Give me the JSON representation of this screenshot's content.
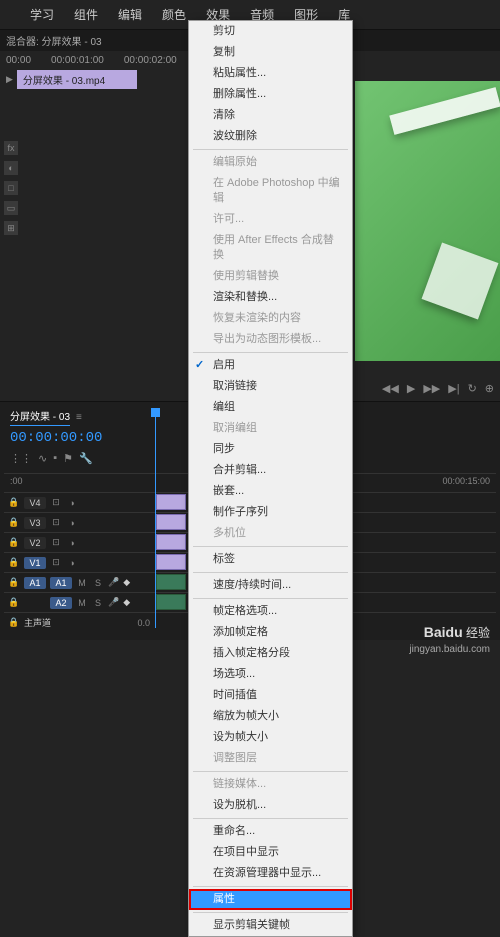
{
  "topMenu": [
    "学习",
    "组件",
    "编辑",
    "颜色",
    "效果",
    "音频",
    "图形",
    "库"
  ],
  "sourcePanel": {
    "title": "混合器: 分屏效果 - 03",
    "timecodes": [
      "00:00",
      "00:00:01:00",
      "00:00:02:00"
    ],
    "clipName": "分屏效果 - 03.mp4"
  },
  "contextMenu": {
    "items": [
      {
        "label": "剪切",
        "type": "item"
      },
      {
        "label": "复制",
        "type": "item"
      },
      {
        "label": "粘贴属性...",
        "type": "item"
      },
      {
        "label": "删除属性...",
        "type": "item"
      },
      {
        "label": "清除",
        "type": "item"
      },
      {
        "label": "波纹删除",
        "type": "item"
      },
      {
        "type": "sep"
      },
      {
        "label": "编辑原始",
        "type": "item",
        "disabled": true
      },
      {
        "label": "在 Adobe Photoshop 中编辑",
        "type": "item",
        "disabled": true
      },
      {
        "label": "许可...",
        "type": "item",
        "disabled": true
      },
      {
        "label": "使用 After Effects 合成替换",
        "type": "item",
        "disabled": true
      },
      {
        "label": "使用剪辑替换",
        "type": "item",
        "disabled": true
      },
      {
        "label": "渲染和替换...",
        "type": "item"
      },
      {
        "label": "恢复未渲染的内容",
        "type": "item",
        "disabled": true
      },
      {
        "label": "导出为动态图形模板...",
        "type": "item",
        "disabled": true
      },
      {
        "type": "sep"
      },
      {
        "label": "启用",
        "type": "item",
        "checked": true
      },
      {
        "label": "取消链接",
        "type": "item"
      },
      {
        "label": "编组",
        "type": "item"
      },
      {
        "label": "取消编组",
        "type": "item",
        "disabled": true
      },
      {
        "label": "同步",
        "type": "item"
      },
      {
        "label": "合并剪辑...",
        "type": "item"
      },
      {
        "label": "嵌套...",
        "type": "item"
      },
      {
        "label": "制作子序列",
        "type": "item"
      },
      {
        "label": "多机位",
        "type": "item",
        "disabled": true
      },
      {
        "type": "sep"
      },
      {
        "label": "标签",
        "type": "item"
      },
      {
        "type": "sep"
      },
      {
        "label": "速度/持续时间...",
        "type": "item"
      },
      {
        "type": "sep"
      },
      {
        "label": "帧定格选项...",
        "type": "item"
      },
      {
        "label": "添加帧定格",
        "type": "item"
      },
      {
        "label": "插入帧定格分段",
        "type": "item"
      },
      {
        "label": "场选项...",
        "type": "item"
      },
      {
        "label": "时间插值",
        "type": "item"
      },
      {
        "label": "缩放为帧大小",
        "type": "item"
      },
      {
        "label": "设为帧大小",
        "type": "item"
      },
      {
        "label": "调整图层",
        "type": "item",
        "disabled": true
      },
      {
        "type": "sep"
      },
      {
        "label": "链接媒体...",
        "type": "item",
        "disabled": true
      },
      {
        "label": "设为脱机...",
        "type": "item"
      },
      {
        "type": "sep"
      },
      {
        "label": "重命名...",
        "type": "item"
      },
      {
        "label": "在项目中显示",
        "type": "item"
      },
      {
        "label": "在资源管理器中显示...",
        "type": "item"
      },
      {
        "type": "sep"
      },
      {
        "label": "属性",
        "type": "item",
        "highlighted": true,
        "redbox": true
      },
      {
        "type": "sep"
      },
      {
        "label": "显示剪辑关键帧",
        "type": "item"
      }
    ]
  },
  "timeline": {
    "sequenceName": "分屏效果 - 03",
    "timecode": "00:00:00:00",
    "rulerStart": ":00",
    "rulerEnd": "00:00:15:00",
    "tracks": [
      {
        "label": "V4",
        "type": "video"
      },
      {
        "label": "V3",
        "type": "video"
      },
      {
        "label": "V2",
        "type": "video"
      },
      {
        "label": "V1",
        "type": "video",
        "active": true
      },
      {
        "label": "A1",
        "type": "audio",
        "prefix": "A1"
      },
      {
        "label": "A2",
        "type": "audio"
      },
      {
        "label": "主声道",
        "type": "master"
      }
    ]
  },
  "watermark": {
    "brand": "Baidu",
    "sub": "经验",
    "url": "jingyan.baidu.com"
  }
}
